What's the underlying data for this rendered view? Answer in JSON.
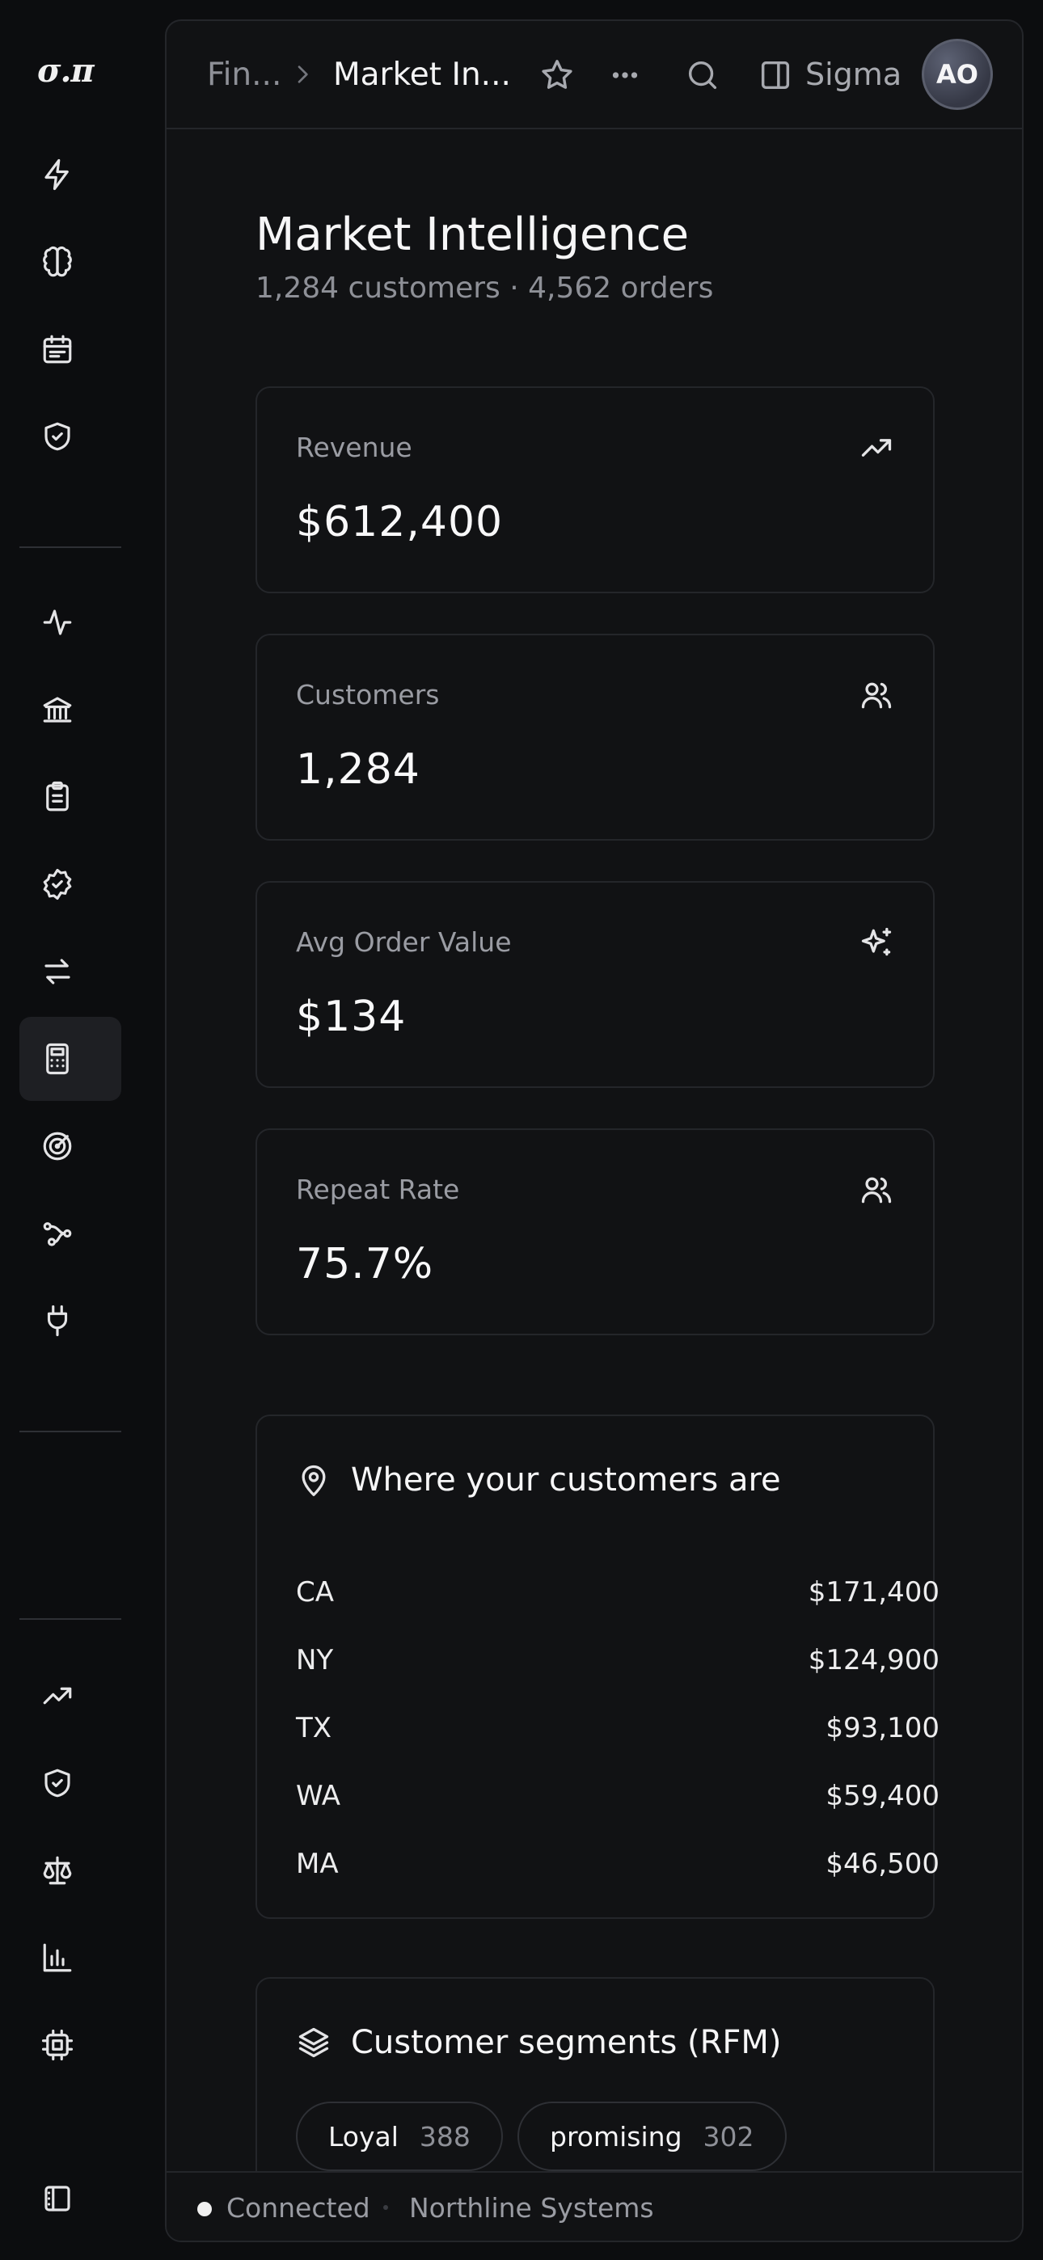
{
  "app": {
    "logo": "σ.π"
  },
  "sidebar": {
    "items": [
      {
        "icon": "bolt-icon"
      },
      {
        "icon": "brain-icon"
      },
      {
        "icon": "calendar-icon"
      },
      {
        "icon": "shield-check-icon"
      },
      {
        "icon": "activity-icon"
      },
      {
        "icon": "bank-icon"
      },
      {
        "icon": "clipboard-icon"
      },
      {
        "icon": "badge-check-icon"
      },
      {
        "icon": "transfer-arrows-icon"
      },
      {
        "icon": "calculator-icon",
        "active": true
      },
      {
        "icon": "target-icon"
      },
      {
        "icon": "workflow-icon"
      },
      {
        "icon": "plug-icon"
      },
      {
        "icon": "trending-up-icon"
      },
      {
        "icon": "shield-check-icon"
      },
      {
        "icon": "scale-icon"
      },
      {
        "icon": "bar-chart-icon"
      },
      {
        "icon": "cpu-icon"
      },
      {
        "icon": "sidebar-toggle-icon"
      }
    ]
  },
  "topbar": {
    "breadcrumb_parent": "Fin...",
    "breadcrumb_current": "Market In...",
    "workspace_label": "Sigma",
    "avatar_initials": "AO"
  },
  "page": {
    "title": "Market Intelligence",
    "subtitle": "1,284 customers · 4,562 orders"
  },
  "kpis": [
    {
      "label": "Revenue",
      "value": "$612,400",
      "icon": "trending-up-icon"
    },
    {
      "label": "Customers",
      "value": "1,284",
      "icon": "users-icon"
    },
    {
      "label": "Avg Order Value",
      "value": "$134",
      "icon": "sparkles-icon"
    },
    {
      "label": "Repeat Rate",
      "value": "75.7%",
      "icon": "users-icon"
    }
  ],
  "geo": {
    "title": "Where your customers are",
    "icon": "map-pin-icon",
    "rows": [
      {
        "state": "CA",
        "amount": "$171,400"
      },
      {
        "state": "NY",
        "amount": "$124,900"
      },
      {
        "state": "TX",
        "amount": "$93,100"
      },
      {
        "state": "WA",
        "amount": "$59,400"
      },
      {
        "state": "MA",
        "amount": "$46,500"
      }
    ]
  },
  "segments": {
    "title": "Customer segments (RFM)",
    "icon": "layers-icon",
    "chips": [
      {
        "name": "Loyal",
        "count": "388"
      },
      {
        "name": "promising",
        "count": "302"
      }
    ]
  },
  "status": {
    "connection": "Connected",
    "org": "Northline Systems"
  }
}
